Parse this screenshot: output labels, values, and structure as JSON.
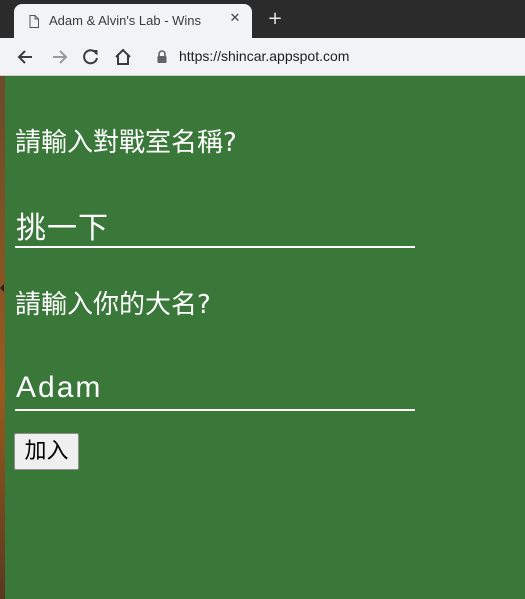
{
  "browser": {
    "tab_title": "Adam & Alvin's Lab - Wins",
    "close_glyph": "✕",
    "new_tab_glyph": "+",
    "url": "https://shincar.appspot.com",
    "icons": [
      "document-icon",
      "back-arrow-icon",
      "forward-arrow-icon",
      "reload-icon",
      "home-icon",
      "lock-icon"
    ]
  },
  "form": {
    "room_label": "請輸入對戰室名稱?",
    "room_value": "挑一下",
    "name_label": "請輸入你的大名?",
    "name_value": "Adam",
    "join_label": "加入"
  },
  "colors": {
    "page_background": "#397839",
    "text": "#ffffff",
    "tab_strip": "#2b2b2b",
    "toolbar": "#f1f3f4"
  }
}
